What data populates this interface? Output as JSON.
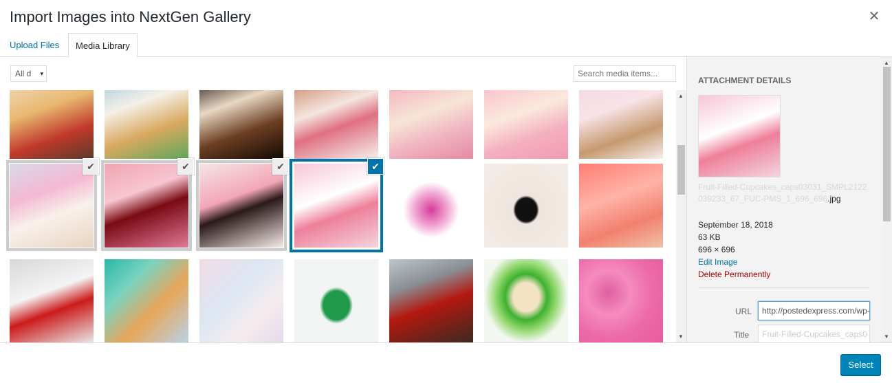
{
  "modal": {
    "title": "Import Images into NextGen Gallery",
    "close_glyph": "✕"
  },
  "tabs": [
    {
      "label": "Upload Files"
    },
    {
      "label": "Media Library"
    }
  ],
  "toolbar": {
    "filter_value": "All d",
    "filter_arrow": "▾",
    "search_placeholder": "Search media items..."
  },
  "grid": {
    "check_glyph": "✔",
    "items": [
      {
        "icon": "cupcake-strawberry-image",
        "bg": "linear-gradient(160deg,#f3e0c8 0%,#e8b870 40%,#c0392b 70%,#5a3a2a 100%)",
        "state": "none"
      },
      {
        "icon": "cupcake-tray-image",
        "bg": "linear-gradient(160deg,#9ecae1 0%,#f5f0e6 35%,#d9a860 65%,#5da85a 100%)",
        "state": "none"
      },
      {
        "icon": "chocolate-cupcake-image",
        "bg": "linear-gradient(160deg,#1a0f0a 0%,#e8d7c3 35%,#6b3e22 65%,#140a05 100%)",
        "state": "none"
      },
      {
        "icon": "cupcake-pearls-image",
        "bg": "linear-gradient(160deg,#c77a5a 0%,#f4e6e0 40%,#e07080 60%,#f5f1ee 100%)",
        "state": "none"
      },
      {
        "icon": "pink-flower-cupcake-image",
        "bg": "linear-gradient(160deg,#f3a6bd 0%,#f7e5d4 45%,#f0b4c2 70%,#e58aa4 100%)",
        "state": "none"
      },
      {
        "icon": "pink-flower-cupcake-image",
        "bg": "linear-gradient(160deg,#f7b7c8 0%,#fbe9dc 45%,#f4b0c0 70%,#f29ab2 100%)",
        "state": "none"
      },
      {
        "icon": "heart-cupcakes-image",
        "bg": "linear-gradient(160deg,#f0d7de 0%,#f9e3e8 40%,#c59a6e 70%,#f7eef0 100%)",
        "state": "none"
      },
      {
        "icon": "rose-cupcake-image",
        "bg": "linear-gradient(160deg,#d9d9e8 0%,#f4b8d3 35%,#f8f1ea 60%,#e9d4c0 100%)",
        "state": "selected"
      },
      {
        "icon": "cherry-cupcake-image",
        "bg": "linear-gradient(160deg,#f2a3b3 0%,#f7c6d0 35%,#7a0a12 55%,#e07a9a 100%)",
        "state": "selected"
      },
      {
        "icon": "pink-cupcakes-pearls-image",
        "bg": "linear-gradient(160deg,#f5e6e6 0%,#f3a6b7 40%,#2a1a1a 55%,#f7ecea 100%)",
        "state": "selected"
      },
      {
        "icon": "fruit-filled-cupcake-image",
        "bg": "linear-gradient(160deg,#f7c6d6 0%,#ffffff 40%,#ef7f9a 60%,#f2d5df 100%)",
        "state": "active"
      },
      {
        "icon": "purple-cupcake-image",
        "bg": "radial-gradient(circle at 50% 55%,#d63d9a 0%,#f0a0d0 25%,#ffffff 45%)",
        "state": "none"
      },
      {
        "icon": "woman-black-dress-image",
        "bg": "radial-gradient(ellipse at 50% 55%,#111 0%,#111 18%,#efe5df 22%,#f4ece6 100%)",
        "state": "none"
      },
      {
        "icon": "pink-frosting-cupcake-image",
        "bg": "linear-gradient(160deg,#ff7d72 0%,#ffb3a8 40%,#f2806e 70%,#f0c1a8 100%)",
        "state": "none"
      },
      {
        "icon": "red-toy-car-image",
        "bg": "linear-gradient(160deg,#d8d8d8 0%,#f4f4f4 40%,#cc1b1b 60%,#e9e9e9 100%)",
        "state": "none"
      },
      {
        "icon": "abstract-paint-image",
        "bg": "linear-gradient(135deg,#2ab7a9 0%,#7ad3c0 30%,#e8a55a 60%,#b7d3e8 100%)",
        "state": "none"
      },
      {
        "icon": "pastel-watercolor-image",
        "bg": "linear-gradient(135deg,#f3dbe6 0%,#dbe7f2 40%,#f6ecef 70%,#e3d9ec 100%)",
        "state": "none"
      },
      {
        "icon": "green-toy-car-image",
        "bg": "radial-gradient(ellipse at 50% 55%,#1e9a4a 0%,#1e9a4a 22%,#f2f4f3 28%)",
        "state": "none"
      },
      {
        "icon": "vintage-car-image",
        "bg": "linear-gradient(160deg,#bfc5cc 0%,#8a8f95 30%,#b3180f 55%,#3a2a22 100%)",
        "state": "none"
      },
      {
        "icon": "green-cream-jar-image",
        "bg": "radial-gradient(ellipse at 50% 45%,#f4e2c4 0%,#f4e2c4 22%,#3db12f 35%,#8ed66a 50%,#f2f7ef 70%)",
        "state": "none"
      },
      {
        "icon": "pink-donuts-image",
        "bg": "radial-gradient(circle at 35% 40%,#e05fa1 0%,#f58bbf 30%,#ec6aa8 60%,#e85ba0 100%)",
        "state": "none"
      }
    ]
  },
  "sidebar": {
    "heading": "Attachment Details",
    "thumb_icon": "fruit-filled-cupcake-image",
    "filename_faded": "Fruit-Filled-Cupcakes_caps03031_SMPL2122039233_67_FUC-PMS_1_696_696",
    "filename_visible": ".jpg",
    "date": "September 18, 2018",
    "size": "63 KB",
    "dimensions": "696 × 696",
    "edit_link": "Edit Image",
    "delete_link": "Delete Permanently",
    "url_label": "URL",
    "url_value": "http://postedexpress.com/wp-...",
    "title_label": "Title",
    "title_value": "Fruit-Filled-Cupcakes_caps0"
  },
  "footer": {
    "select_label": "Select"
  },
  "colors": {
    "accent": "#0073aa",
    "danger": "#a00",
    "primary_button": "#0085ba"
  }
}
